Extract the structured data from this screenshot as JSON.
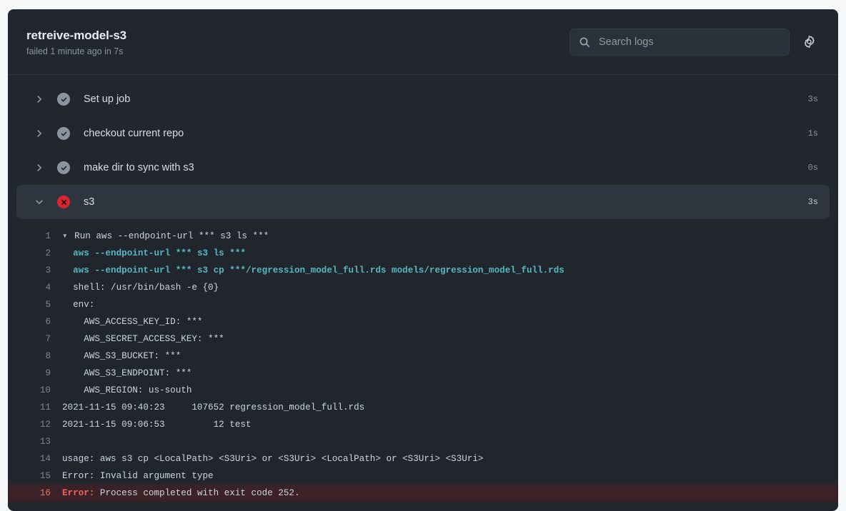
{
  "header": {
    "title": "retreive-model-s3",
    "subtitle": "failed 1 minute ago in 7s",
    "search_placeholder": "Search logs",
    "search_value": "",
    "search_icon": "search-icon",
    "settings_icon": "gear-icon"
  },
  "steps": [
    {
      "label": "Set up job",
      "status": "success",
      "duration": "3s",
      "expanded": false,
      "chevron": "chevron-right-icon"
    },
    {
      "label": "checkout current repo",
      "status": "success",
      "duration": "1s",
      "expanded": false,
      "chevron": "chevron-right-icon"
    },
    {
      "label": "make dir to sync with s3",
      "status": "success",
      "duration": "0s",
      "expanded": false,
      "chevron": "chevron-right-icon"
    },
    {
      "label": "s3",
      "status": "failure",
      "duration": "3s",
      "expanded": true,
      "chevron": "chevron-down-icon"
    }
  ],
  "log": {
    "lines": [
      {
        "n": "1",
        "segments": [
          {
            "text": "▾ ",
            "style": "tri"
          },
          {
            "text": "Run aws --endpoint-url *** s3 ls ***",
            "style": "plain"
          }
        ]
      },
      {
        "n": "2",
        "segments": [
          {
            "text": "  ",
            "style": "plain"
          },
          {
            "text": "aws --endpoint-url *** s3 ls ***",
            "style": "cmd"
          }
        ]
      },
      {
        "n": "3",
        "segments": [
          {
            "text": "  ",
            "style": "plain"
          },
          {
            "text": "aws --endpoint-url *** s3 cp ***/regression_model_full.rds models/regression_model_full.rds",
            "style": "cmd"
          }
        ]
      },
      {
        "n": "4",
        "segments": [
          {
            "text": "  shell: /usr/bin/bash -e {0}",
            "style": "plain"
          }
        ]
      },
      {
        "n": "5",
        "segments": [
          {
            "text": "  env:",
            "style": "plain"
          }
        ]
      },
      {
        "n": "6",
        "segments": [
          {
            "text": "    AWS_ACCESS_KEY_ID: ***",
            "style": "plain"
          }
        ]
      },
      {
        "n": "7",
        "segments": [
          {
            "text": "    AWS_SECRET_ACCESS_KEY: ***",
            "style": "plain"
          }
        ]
      },
      {
        "n": "8",
        "segments": [
          {
            "text": "    AWS_S3_BUCKET: ***",
            "style": "plain"
          }
        ]
      },
      {
        "n": "9",
        "segments": [
          {
            "text": "    AWS_S3_ENDPOINT: ***",
            "style": "plain"
          }
        ]
      },
      {
        "n": "10",
        "segments": [
          {
            "text": "    AWS_REGION: us-south",
            "style": "plain"
          }
        ]
      },
      {
        "n": "11",
        "segments": [
          {
            "text": "2021-11-15 09:40:23     107652 regression_model_full.rds",
            "style": "plain"
          }
        ]
      },
      {
        "n": "12",
        "segments": [
          {
            "text": "2021-11-15 09:06:53         12 test",
            "style": "plain"
          }
        ]
      },
      {
        "n": "13",
        "segments": [
          {
            "text": "",
            "style": "plain"
          }
        ]
      },
      {
        "n": "14",
        "segments": [
          {
            "text": "usage: aws s3 cp <LocalPath> <S3Uri> or <S3Uri> <LocalPath> or <S3Uri> <S3Uri>",
            "style": "plain"
          }
        ]
      },
      {
        "n": "15",
        "segments": [
          {
            "text": "Error: Invalid argument type",
            "style": "plain"
          }
        ]
      },
      {
        "n": "16",
        "error": true,
        "segments": [
          {
            "text": "Error:",
            "style": "err"
          },
          {
            "text": " Process completed with exit code 252.",
            "style": "plain"
          }
        ]
      }
    ]
  },
  "colors": {
    "page_background": "#f6f8fa",
    "card_background": "#22272e",
    "log_background": "#21262d",
    "active_row": "#2f353e",
    "success": "#8b949e",
    "failure": "#d7262c",
    "command": "#56b6c2",
    "error_text": "#f2635c",
    "error_row_background": "#3a2227"
  }
}
